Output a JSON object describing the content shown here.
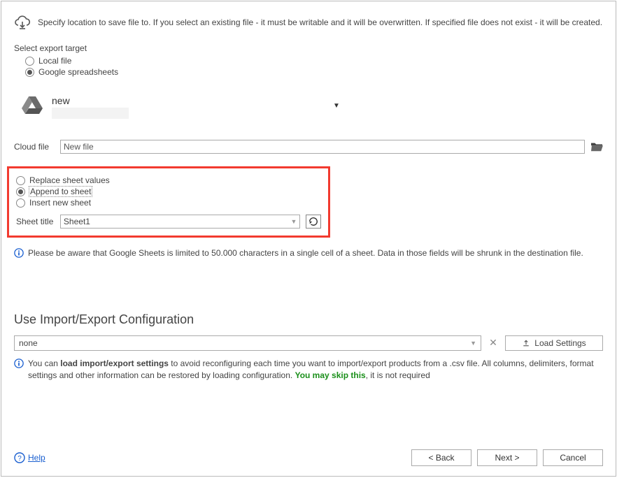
{
  "description": "Specify location to save file to. If you select an existing file - it must be writable and it will be overwritten. If specified file does not exist - it will be created.",
  "export_target": {
    "label": "Select export target",
    "options": {
      "local": "Local file",
      "google": "Google spreadsheets"
    },
    "selected": "google"
  },
  "account": {
    "name": "new"
  },
  "cloud_file": {
    "label": "Cloud file",
    "value": "New file"
  },
  "sheet_mode": {
    "options": {
      "replace": "Replace sheet values",
      "append": "Append to sheet",
      "insert": "Insert new sheet"
    },
    "selected": "append"
  },
  "sheet_title": {
    "label": "Sheet title",
    "value": "Sheet1"
  },
  "warning_sheets": "Please be aware that Google Sheets is limited to 50.000 characters in a single cell of a sheet. Data in those fields will be shrunk in the destination file.",
  "ie_config": {
    "heading": "Use Import/Export Configuration",
    "value": "none",
    "load_label": "Load Settings",
    "info_pre": "You can ",
    "info_bold": "load import/export settings",
    "info_mid": " to avoid reconfiguring each time you want to import/export products from a .csv file. All columns, delimiters, format settings and other information can be restored by loading configuration. ",
    "info_green": "You may skip this",
    "info_tail": ", it is not required"
  },
  "buttons": {
    "back": "< Back",
    "next": "Next >",
    "cancel": "Cancel",
    "help": "Help"
  }
}
